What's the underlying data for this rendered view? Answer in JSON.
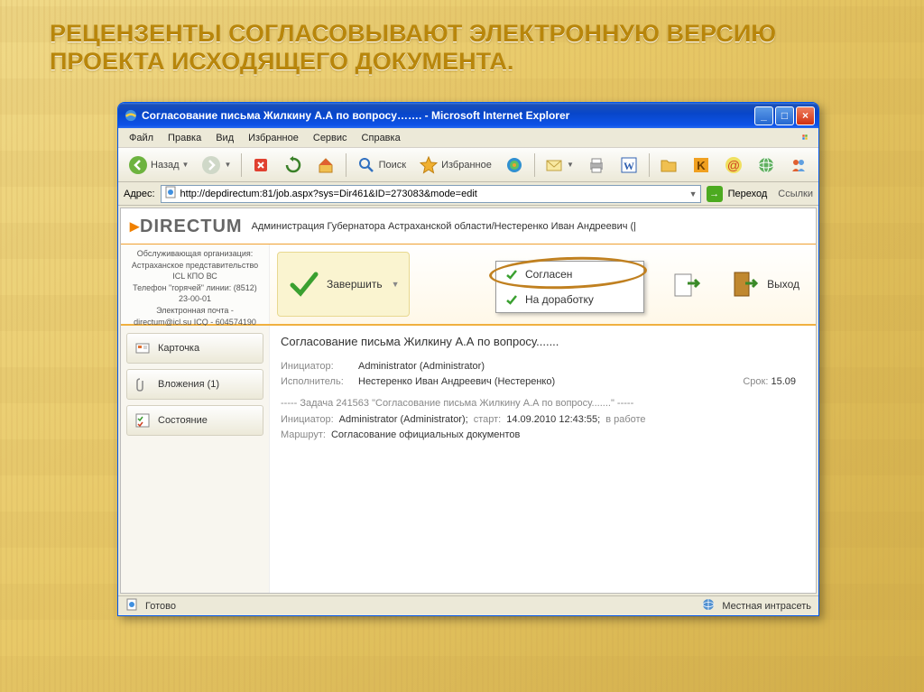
{
  "slide": {
    "title": "РЕЦЕНЗЕНТЫ СОГЛАСОВЫВАЮТ ЭЛЕКТРОННУЮ ВЕРСИЮ ПРОЕКТА ИСХОДЯЩЕГО ДОКУМЕНТА."
  },
  "window": {
    "title": "Согласование письма Жилкину А.А по вопросу……. - Microsoft Internet Explorer"
  },
  "menu": {
    "file": "Файл",
    "edit": "Правка",
    "view": "Вид",
    "favorites": "Избранное",
    "tools": "Сервис",
    "help": "Справка"
  },
  "toolbar": {
    "back": "Назад",
    "search": "Поиск",
    "favorites": "Избранное"
  },
  "address": {
    "label": "Адрес:",
    "value": "http://depdirectum:81/job.aspx?sys=Dir461&ID=273083&mode=edit",
    "go": "Переход",
    "links": "Ссылки"
  },
  "directum": {
    "logo_text": "DIRECTUM",
    "subtitle": "Администрация Губернатора Астраханской области/Нестеренко Иван Андреевич (|"
  },
  "org": {
    "l1": "Обслуживающая организация:",
    "l2": "Астраханское представительство",
    "l3": "ICL КПО ВС",
    "l4": "Телефон \"горячей\" линии: (8512)",
    "l5": "23-00-01",
    "l6": "Электронная почта -",
    "l7": "directum@icl.su ICQ - 604574190"
  },
  "actions": {
    "complete": "Завершить",
    "exit": "Выход"
  },
  "dropdown": {
    "agree": "Согласен",
    "rework": "На доработку"
  },
  "tabs": {
    "card": "Карточка",
    "attachments": "Вложения (1)",
    "status": "Состояние"
  },
  "doc": {
    "title": "Согласование письма Жилкину А.А по вопросу.......",
    "initiator_lbl": "Инициатор:",
    "initiator": "Administrator (Administrator)",
    "performer_lbl": "Исполнитель:",
    "performer": "Нестеренко Иван Андреевич (Нестеренко)",
    "srok_lbl": "Срок:",
    "srok": "15.09",
    "task_line": "----- Задача 241563 \"Согласование письма Жилкину А.А по вопросу.......\" -----",
    "init2_lbl": "Инициатор:",
    "init2": "Administrator (Administrator);",
    "start_lbl": "старт:",
    "start": "14.09.2010 12:43:55;",
    "status_txt": "в работе",
    "route_lbl": "Маршрут:",
    "route": "Согласование официальных документов"
  },
  "status": {
    "ready": "Готово",
    "zone": "Местная интрасеть"
  }
}
